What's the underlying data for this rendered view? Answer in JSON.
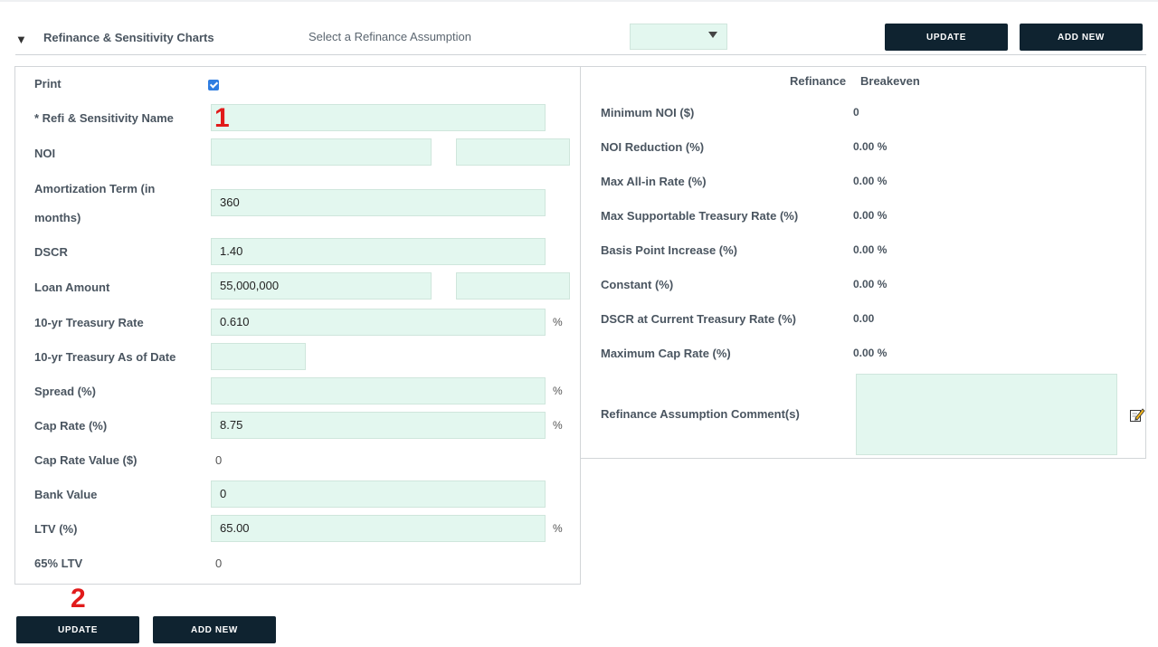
{
  "header": {
    "title": "Refinance & Sensitivity Charts",
    "select_label": "Select a Refinance Assumption",
    "dropdown_value": "",
    "update_label": "UPDATE",
    "add_new_label": "ADD NEW"
  },
  "form": {
    "print_label": "Print",
    "print_checked": true,
    "name_label": "* Refi & Sensitivity Name",
    "name_value": "",
    "noi_label": "NOI",
    "noi_value_1": "",
    "noi_value_2": "",
    "amort_label": "Amortization Term (in",
    "amort_label_2": "months)",
    "amort_value": "360",
    "dscr_label": "DSCR",
    "dscr_value": "1.40",
    "loan_label": "Loan Amount",
    "loan_value": "55,000,000",
    "loan_value_2": "",
    "treasury_label": "10-yr Treasury Rate",
    "treasury_value": "0.610",
    "treasury_date_label": "10-yr Treasury As of Date",
    "treasury_date_value": "",
    "spread_label": "Spread (%)",
    "spread_value": "",
    "cap_label": "Cap Rate (%)",
    "cap_value": "8.75",
    "cap_value_label": "Cap Rate Value ($)",
    "cap_value_value": "0",
    "bank_label": "Bank Value",
    "bank_value": "0",
    "ltv_label": "LTV (%)",
    "ltv_value": "65.00",
    "ltv65_label": "65% LTV",
    "ltv65_value": "0",
    "pct": "%"
  },
  "breakeven": {
    "col1": "Refinance",
    "col2": "Breakeven",
    "rows": [
      {
        "label": "Minimum NOI ($)",
        "value": "0"
      },
      {
        "label": "NOI Reduction (%)",
        "value": "0.00 %"
      },
      {
        "label": "Max All-in Rate (%)",
        "value": "0.00 %"
      },
      {
        "label": "Max Supportable Treasury Rate (%)",
        "value": "0.00 %"
      },
      {
        "label": "Basis Point Increase (%)",
        "value": "0.00 %"
      },
      {
        "label": "Constant (%)",
        "value": "0.00 %"
      },
      {
        "label": "DSCR at Current Treasury Rate (%)",
        "value": "0.00"
      },
      {
        "label": "Maximum Cap Rate (%)",
        "value": "0.00 %"
      }
    ],
    "comment_label": "Refinance Assumption Comment(s)",
    "comment_value": ""
  },
  "footer": {
    "update_label": "UPDATE",
    "add_new_label": "ADD NEW"
  },
  "annotations": {
    "one": "1",
    "two": "2"
  },
  "colors": {
    "button_bg": "#0f2330",
    "input_bg": "#e3f7ef",
    "annotation": "#e11b1b",
    "checkbox": "#2f7de1"
  }
}
